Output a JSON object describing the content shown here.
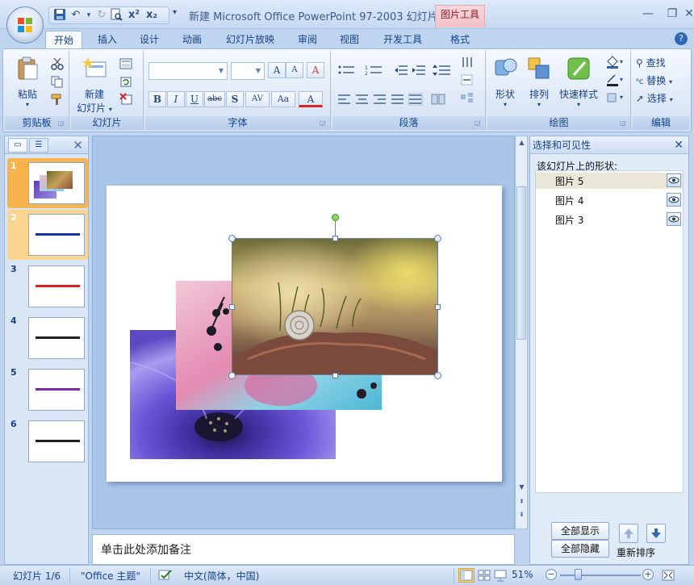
{
  "window": {
    "title": "新建 Microsoft Office PowerPoint 97-2003 幻灯片...",
    "contextual_tab_group": "图片工具",
    "minimize": "—",
    "restore": "❐",
    "close": "✕"
  },
  "quick_access": {
    "save_icon": "save-icon",
    "undo_icon": "undo-icon",
    "redo_icon": "redo-icon",
    "preview_icon": "print-preview-icon",
    "superscript": "x²",
    "subscript": "x₂",
    "customize": "▾"
  },
  "ribbon_tabs": [
    "开始",
    "插入",
    "设计",
    "动画",
    "幻灯片放映",
    "审阅",
    "视图",
    "开发工具",
    "格式"
  ],
  "active_tab": "开始",
  "help": "?",
  "groups": {
    "clipboard": {
      "label": "剪贴板",
      "paste": "粘贴"
    },
    "slides": {
      "label": "幻灯片",
      "new_slide_line1": "新建",
      "new_slide_line2": "幻灯片"
    },
    "font": {
      "label": "字体",
      "font_name": "",
      "font_size": "",
      "grow": "A",
      "shrink": "A",
      "clear": "A",
      "bold": "B",
      "italic": "I",
      "underline": "U",
      "strike": "abc",
      "shadow": "S",
      "spacing": "AV",
      "case": "Aa",
      "color": "A"
    },
    "paragraph": {
      "label": "段落"
    },
    "drawing": {
      "label": "绘图",
      "shapes": "形状",
      "arrange": "排列",
      "quick_styles": "快速样式"
    },
    "editing": {
      "label": "编辑",
      "find": "查找",
      "replace": "替换",
      "select": "选择"
    }
  },
  "slides_pane": {
    "close": "✕",
    "thumbnails": [
      {
        "num": "1",
        "selected": true,
        "kind": "images"
      },
      {
        "num": "2",
        "selected": false,
        "kind": "text",
        "text_color": "#1a2fa8",
        "highlight": true
      },
      {
        "num": "3",
        "selected": false,
        "kind": "text",
        "text_color": "#d42424"
      },
      {
        "num": "4",
        "selected": false,
        "kind": "text",
        "text_color": "#222222"
      },
      {
        "num": "5",
        "selected": false,
        "kind": "text",
        "text_color": "#7a2aa8"
      },
      {
        "num": "6",
        "selected": false,
        "kind": "text",
        "text_color": "#222222"
      }
    ]
  },
  "notes": {
    "placeholder": "单击此处添加备注"
  },
  "selection_pane": {
    "title": "选择和可见性",
    "close": "✕",
    "subtitle": "该幻灯片上的形状:",
    "shapes": [
      {
        "name": "图片 5",
        "selected": true
      },
      {
        "name": "图片 4",
        "selected": false
      },
      {
        "name": "图片 3",
        "selected": false
      }
    ],
    "show_all": "全部显示",
    "hide_all": "全部隐藏",
    "reorder": "重新排序"
  },
  "status": {
    "slide": "幻灯片 1/6",
    "theme": "\"Office 主题\"",
    "language": "中文(简体，中国)",
    "zoom": "51%",
    "zoom_minus": "−",
    "zoom_plus": "+"
  },
  "colors": {
    "ribbon_blue": "#bfd4ee",
    "contextual_pink": "#f2c2c7",
    "selection_orange": "#f8b44c",
    "accent_text": "#15428b"
  }
}
